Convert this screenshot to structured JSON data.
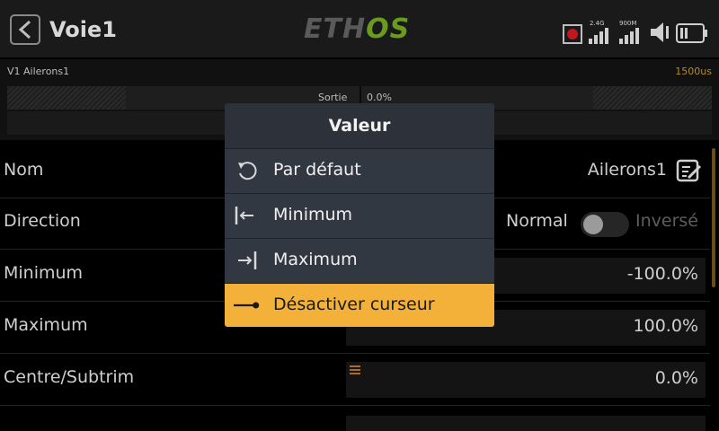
{
  "header": {
    "title": "Voie1",
    "logo": {
      "part1": "ETH",
      "part2": "OS"
    },
    "rf_band": "2.4G",
    "rf2_band": "900M"
  },
  "channel": {
    "label": "V1  Ailerons1",
    "pulse": "1500us",
    "output_label": "Sortie",
    "output_value": "0.0%"
  },
  "rows": {
    "name": {
      "label": "Nom",
      "value": "Ailerons1"
    },
    "direction": {
      "label": "Direction",
      "normal": "Normal",
      "inverse": "Inversé"
    },
    "minimum": {
      "label": "Minimum",
      "value": "-100.0%"
    },
    "maximum": {
      "label": "Maximum",
      "value": "100.0%"
    },
    "center": {
      "label": "Centre/Subtrim",
      "value": "0.0%"
    }
  },
  "popup": {
    "title": "Valeur",
    "items": [
      {
        "label": "Par défaut",
        "icon": "reset-icon"
      },
      {
        "label": "Minimum",
        "icon": "to-min-icon"
      },
      {
        "label": "Maximum",
        "icon": "to-max-icon"
      },
      {
        "label": "Désactiver curseur",
        "icon": "slider-disable-icon",
        "selected": true
      }
    ]
  },
  "colors": {
    "accent": "#f4b13a",
    "logo_green": "#6a9a1e"
  }
}
